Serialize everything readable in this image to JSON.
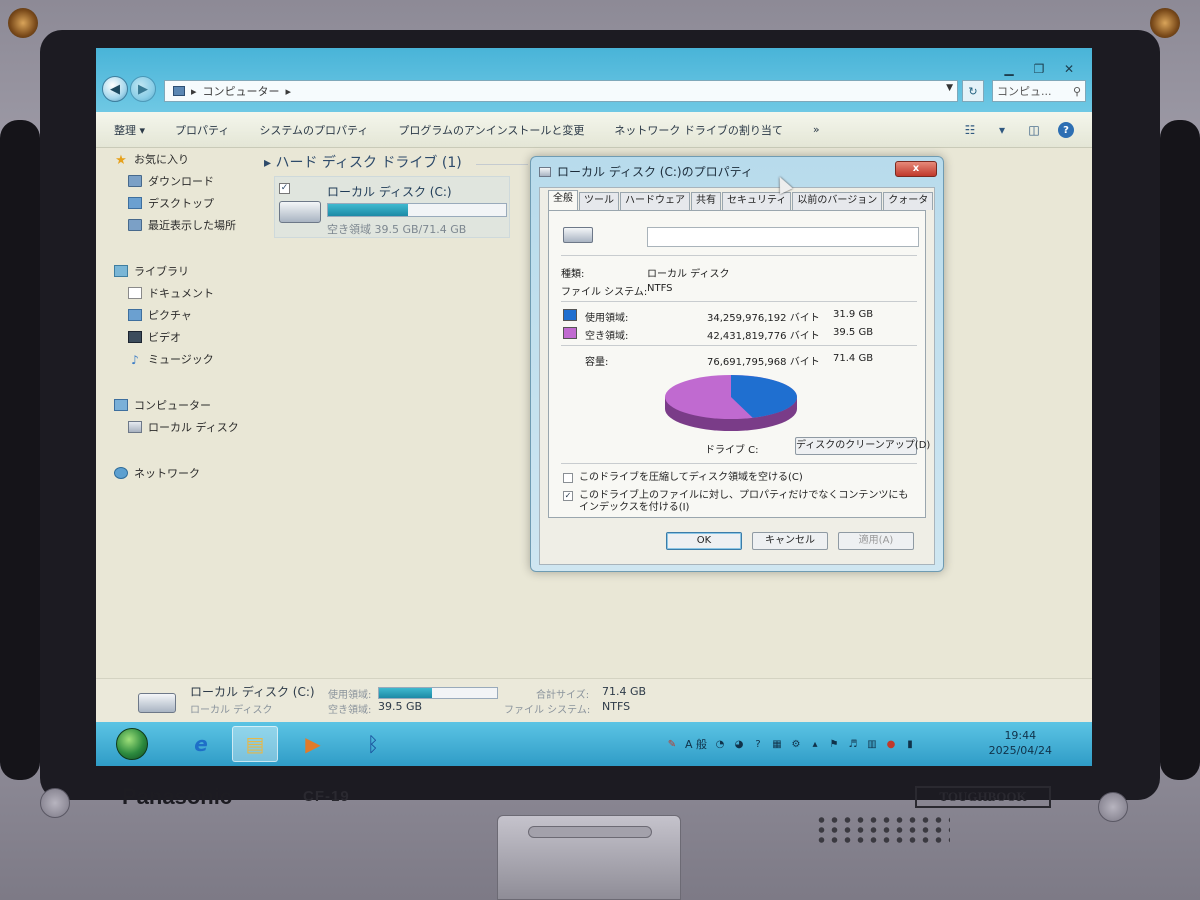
{
  "explorer": {
    "address": {
      "path": "コンピューター",
      "search_placeholder": "コンピュ..."
    },
    "toolbar": [
      "整理 ▾",
      "プロパティ",
      "システムのプロパティ",
      "プログラムのアンインストールと変更",
      "ネットワーク ドライブの割り当て",
      "»"
    ],
    "nav": {
      "favorites": {
        "label": "お気に入り",
        "items": [
          "ダウンロード",
          "デスクトップ",
          "最近表示した場所"
        ]
      },
      "libraries": {
        "label": "ライブラリ",
        "items": [
          "ドキュメント",
          "ピクチャ",
          "ビデオ",
          "ミュージック"
        ]
      },
      "computer": {
        "label": "コンピューター",
        "items": [
          "ローカル ディスク"
        ]
      },
      "network": {
        "label": "ネットワーク"
      }
    },
    "content": {
      "group_header": "ハード ディスク ドライブ (1)",
      "drive": {
        "name": "ローカル ディスク (C:)",
        "free_text": "空き領域 39.5 GB/71.4 GB",
        "used_fraction": 0.447
      }
    },
    "details": {
      "name": "ローカル ディスク (C:)",
      "type": "ローカル ディスク",
      "used_label": "使用領域:",
      "free_label": "空き領域:",
      "free_value": "39.5 GB",
      "total_label": "合計サイズ:",
      "total_value": "71.4 GB",
      "fs_label": "ファイル システム:",
      "fs_value": "NTFS"
    }
  },
  "dialog": {
    "title": "ローカル ディスク (C:)のプロパティ",
    "close": "x",
    "tabs": [
      "全般",
      "ツール",
      "ハードウェア",
      "共有",
      "セキュリティ",
      "以前のバージョン",
      "クォータ"
    ],
    "active_tab": 0,
    "type_label": "種類:",
    "type_value": "ローカル ディスク",
    "fs_label": "ファイル システム:",
    "fs_value": "NTFS",
    "used_label": "使用領域:",
    "used_bytes": "34,259,976,192 バイト",
    "used_gb": "31.9 GB",
    "free_label": "空き領域:",
    "free_bytes": "42,431,819,776 バイト",
    "free_gb": "39.5 GB",
    "capacity_label": "容量:",
    "capacity_bytes": "76,691,795,968 バイト",
    "capacity_gb": "71.4 GB",
    "drive_label": "ドライブ C:",
    "cleanup_button": "ディスクのクリーンアップ(D)",
    "compress_label": "このドライブを圧縮してディスク領域を空ける(C)",
    "compress_checked": false,
    "index_label": "このドライブ上のファイルに対し、プロパティだけでなくコンテンツにもインデックスを付ける(I)",
    "index_checked": true,
    "ok": "OK",
    "cancel": "キャンセル",
    "apply": "適用(A)",
    "colors": {
      "used": "#1f6fd0",
      "free": "#c06ad0"
    }
  },
  "taskbar": {
    "tray_lang": "A 般",
    "clock_time": "19:44",
    "clock_date": "2025/04/24"
  },
  "device": {
    "brand": "Panasonic",
    "model": "CF-19",
    "series": "TOUGHBOOK"
  }
}
